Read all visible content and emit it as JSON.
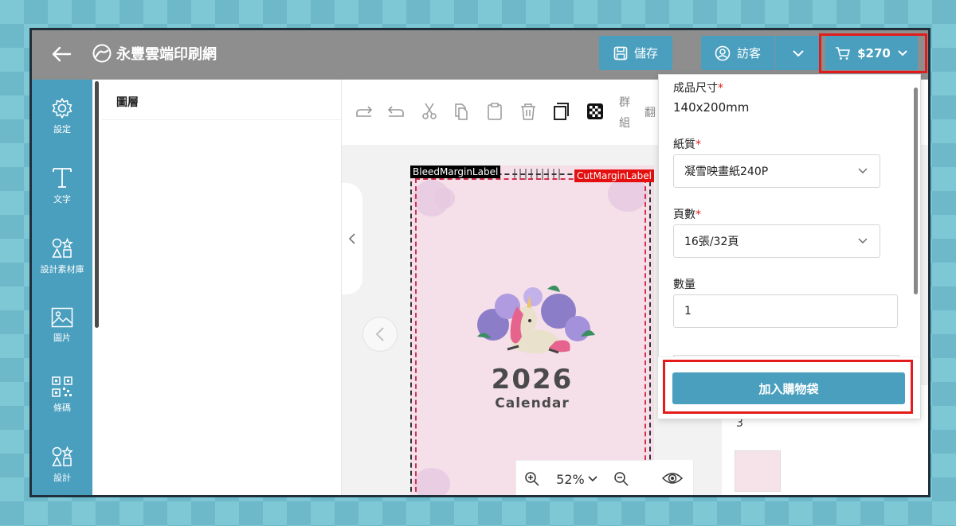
{
  "header": {
    "site_name": "永豐雲端印刷網",
    "save_label": "儲存",
    "user_label": "訪客",
    "cart_total": "$270"
  },
  "sidebar": {
    "items": [
      {
        "label": "設定",
        "icon": "gear-icon"
      },
      {
        "label": "文字",
        "icon": "text-icon"
      },
      {
        "label": "設計素材庫",
        "icon": "shapes-icon"
      },
      {
        "label": "圖片",
        "icon": "image-icon"
      },
      {
        "label": "條碼",
        "icon": "qrcode-icon"
      },
      {
        "label": "設計",
        "icon": "shapes-icon"
      }
    ]
  },
  "layers_panel": {
    "title": "圖層"
  },
  "toolbar": {
    "group_label_1": "群",
    "group_label_2": "組",
    "flip_label": "翻"
  },
  "canvas": {
    "bleed_label": "BleedMarginLabel",
    "cut_label": "CutMarginLabel",
    "year_text": "2026",
    "calendar_text": "Calendar",
    "zoom": "52%"
  },
  "page_panel": {
    "page_number": "3"
  },
  "order_form": {
    "size_label": "成品尺寸",
    "size_value": "140x200mm",
    "paper_label": "紙質",
    "paper_value": "凝雪映畫紙240P",
    "pages_label": "頁數",
    "pages_value": "16張/32頁",
    "quantity_label": "數量",
    "quantity_value": "1",
    "required_mark": "*",
    "add_to_cart": "加入購物袋"
  },
  "colors": {
    "accent": "#4a9fbf",
    "highlight": "#e41b1b",
    "topbar": "#8e8e8e"
  }
}
